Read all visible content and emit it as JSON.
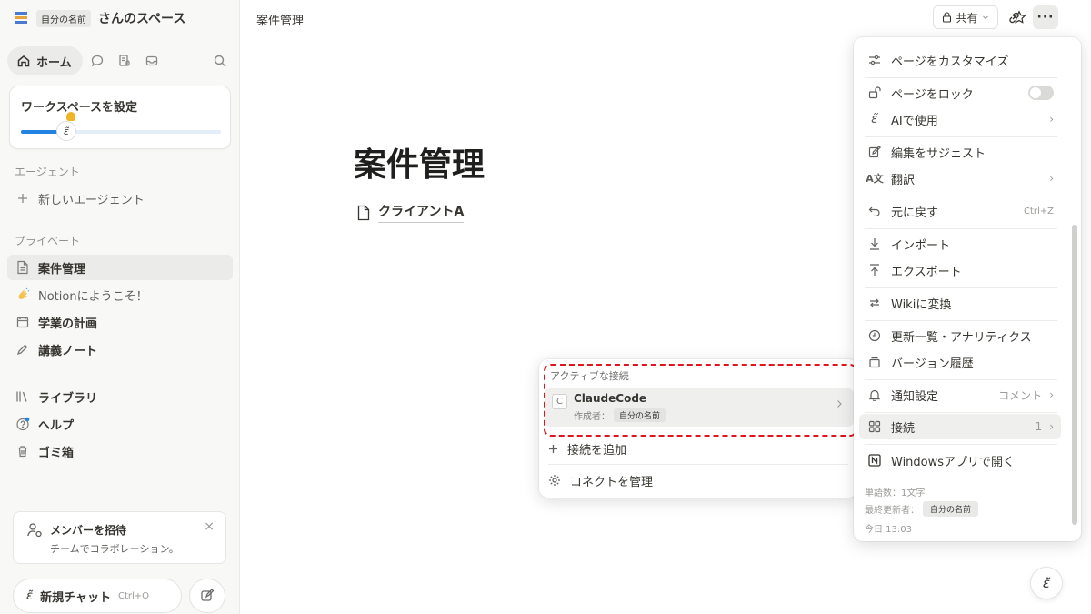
{
  "sidebar": {
    "workspace": {
      "name_chip": "自分の名前",
      "suffix": "さんのスペース"
    },
    "home_label": "ホーム",
    "setup": {
      "title": "ワークスペースを設定",
      "progress": 0.25
    },
    "agents_section": "エージェント",
    "new_agent": "新しいエージェント",
    "private_section": "プライベート",
    "pages": [
      {
        "label": "案件管理",
        "icon": "page-icon"
      },
      {
        "label": "Notionにようこそ！",
        "icon": "wave-icon"
      },
      {
        "label": "学業の計画",
        "icon": "calendar-icon"
      },
      {
        "label": "講義ノート",
        "icon": "pencil-icon"
      }
    ],
    "library": "ライブラリ",
    "help": "ヘルプ",
    "trash": "ゴミ箱",
    "invite": {
      "title": "メンバーを招待",
      "subtitle": "チームでコラボレーション。"
    },
    "new_chat": {
      "label": "新規チャット",
      "shortcut": "Ctrl+O"
    }
  },
  "header": {
    "breadcrumb": "案件管理",
    "share_label": "共有"
  },
  "main": {
    "title": "案件管理",
    "subpage": "クライアントA"
  },
  "connections": {
    "section_label": "アクティブな接続",
    "item": {
      "letter": "C",
      "name": "ClaudeCode",
      "creator_label": "作成者：",
      "creator": "自分の名前"
    },
    "add_label": "接続を追加",
    "manage_label": "コネクトを管理"
  },
  "menu": {
    "customize": "ページをカスタマイズ",
    "lock": "ページをロック",
    "ai_use": "AIで使用",
    "suggest": "編集をサジェスト",
    "translate": "翻訳",
    "undo": "元に戻す",
    "undo_shortcut": "Ctrl+Z",
    "import": "インポート",
    "export": "エクスポート",
    "wiki": "Wikiに変換",
    "updates": "更新一覧・アナリティクス",
    "history": "バージョン履歴",
    "notify": "通知設定",
    "notify_value": "コメント",
    "connections": "接続",
    "connections_count": "1",
    "open_windows": "Windowsアプリで開く",
    "word_count": "単語数：1文字",
    "last_edited_label": "最終更新者：",
    "last_edited_by": "自分の名前",
    "last_edited_time": "今日 13:03"
  },
  "colors": {
    "accent": "#2383e2",
    "highlight_border": "#e0151d"
  }
}
